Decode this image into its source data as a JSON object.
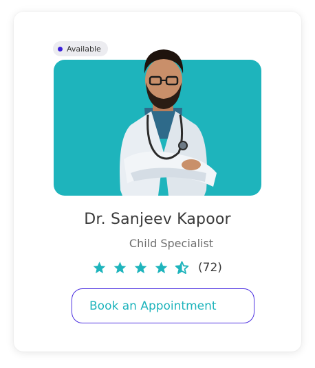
{
  "card": {
    "status_badge": "Available",
    "doctor_name": "Dr. Sanjeev Kapoor",
    "specialty": "Child Specialist",
    "rating": {
      "stars": 4.5,
      "max_stars": 5,
      "count_label": "(72)"
    },
    "cta_label": "Book an Appointment"
  },
  "colors": {
    "accent_teal": "#1eb4bc",
    "accent_purple": "#4a2ee0",
    "badge_dot": "#3a1fd9"
  },
  "icons": [
    "star-icon",
    "half-star-icon",
    "doctor-photo"
  ]
}
